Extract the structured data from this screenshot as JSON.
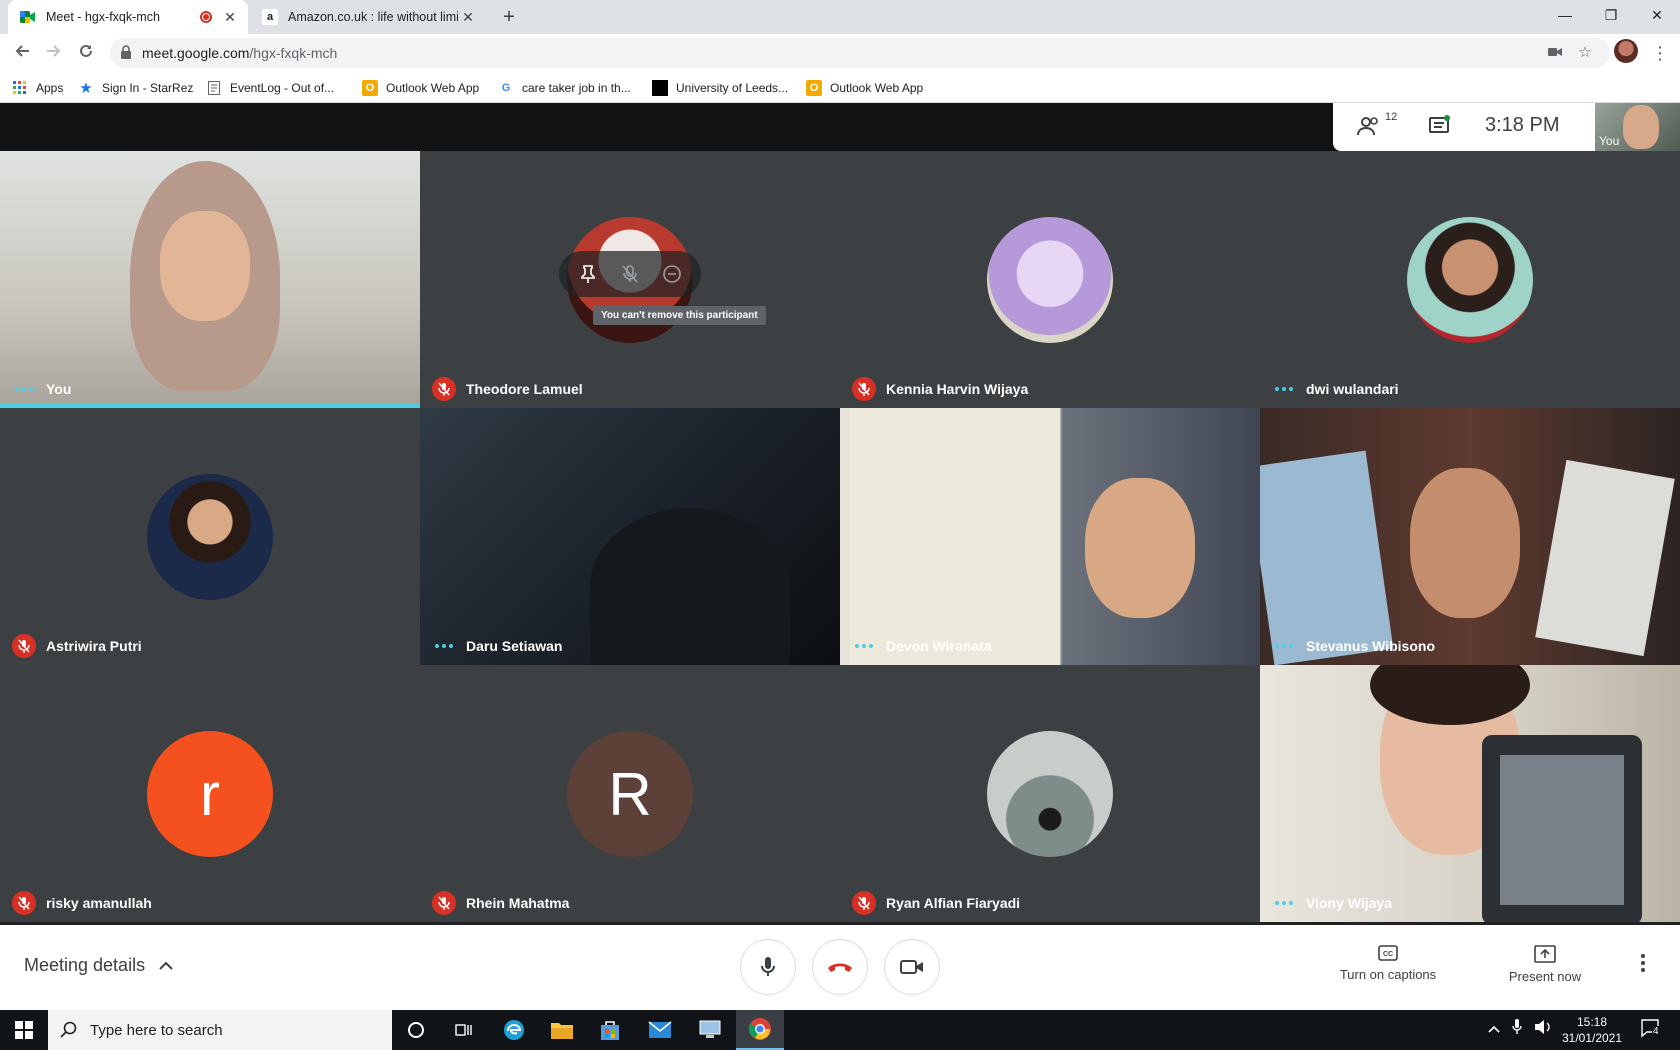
{
  "browser": {
    "tabs": [
      {
        "title": "Meet - hgx-fxqk-mch",
        "active": true,
        "recording": true
      },
      {
        "title": "Amazon.co.uk : life without limits",
        "active": false
      }
    ],
    "url_host": "meet.google.com",
    "url_path": "/hgx-fxqk-mch",
    "bookmarks": [
      {
        "label": "Apps",
        "icon": "apps-grid-icon"
      },
      {
        "label": "Sign In - StarRez",
        "icon": "star-icon"
      },
      {
        "label": "EventLog - Out of...",
        "icon": "doc-icon"
      },
      {
        "label": "Outlook Web App",
        "icon": "outlook-icon"
      },
      {
        "label": "care taker job in th...",
        "icon": "google-icon"
      },
      {
        "label": "University of Leeds...",
        "icon": "leeds-icon"
      },
      {
        "label": "Outlook Web App",
        "icon": "outlook-icon"
      }
    ]
  },
  "meet": {
    "participant_count": "12",
    "clock": "3:18 PM",
    "self_label": "You",
    "participants": [
      {
        "name": "You",
        "status": "speaking-dots"
      },
      {
        "name": "Theodore Lamuel",
        "status": "muted"
      },
      {
        "name": "Kennia Harvin Wijaya",
        "status": "muted"
      },
      {
        "name": "dwi wulandari",
        "status": "speaking-dots"
      },
      {
        "name": "Astriwira Putri",
        "status": "muted"
      },
      {
        "name": "Daru Setiawan",
        "status": "speaking-dots"
      },
      {
        "name": "Devon Wiranata",
        "status": "speaking-dots"
      },
      {
        "name": "Stevanus Wibisono",
        "status": "speaking-dots"
      },
      {
        "name": "risky amanullah",
        "status": "muted",
        "initial": "r",
        "color": "#f4511e"
      },
      {
        "name": "Rhein Mahatma",
        "status": "muted",
        "initial": "R",
        "color": "#5d4037"
      },
      {
        "name": "Ryan Alfian Fiaryadi",
        "status": "muted"
      },
      {
        "name": "Viony Wijaya",
        "status": "speaking-dots"
      }
    ],
    "tooltip": "You can't remove this participant",
    "tile2_initial_r": "r",
    "tile3_initial_R": "R",
    "controls": {
      "meeting_details": "Meeting details",
      "captions": "Turn on captions",
      "present": "Present now"
    }
  },
  "taskbar": {
    "search_placeholder": "Type here to search",
    "time": "15:18",
    "date": "31/01/2021",
    "notifications": "4"
  },
  "colors": {
    "accent_speaking": "#4ecde6",
    "mic_off": "#d93025",
    "tile_bg": "#3c4043"
  }
}
